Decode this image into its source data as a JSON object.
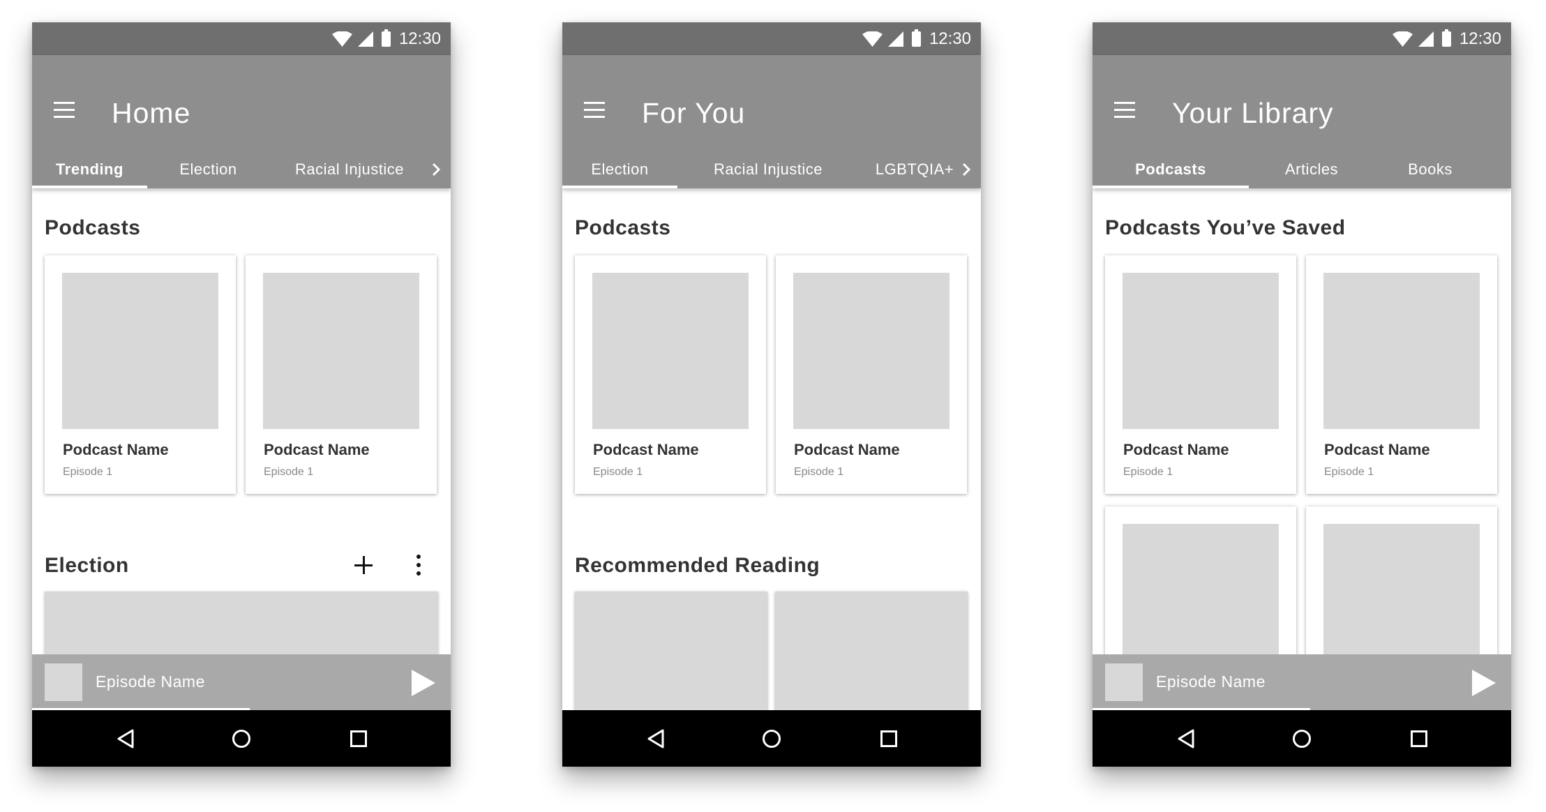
{
  "status_bar": {
    "time": "12:30"
  },
  "screens": [
    {
      "title": "Home",
      "tabs": [
        "Trending",
        "Election",
        "Racial Injustice"
      ],
      "section_1": {
        "title": "Podcasts",
        "cards": [
          {
            "title": "Podcast Name",
            "subtitle": "Episode 1"
          },
          {
            "title": "Podcast Name",
            "subtitle": "Episode 1"
          }
        ]
      },
      "section_2": {
        "title": "Election"
      },
      "mini_player": {
        "episode": "Episode Name",
        "progress": 0.52
      }
    },
    {
      "title": "For You",
      "tabs": [
        "Election",
        "Racial Injustice",
        "LGBTQIA+"
      ],
      "section_1": {
        "title": "Podcasts",
        "cards": [
          {
            "title": "Podcast Name",
            "subtitle": "Episode 1"
          },
          {
            "title": "Podcast Name",
            "subtitle": "Episode 1"
          }
        ]
      },
      "section_2": {
        "title": "Recommended Reading"
      }
    },
    {
      "title": "Your Library",
      "tabs": [
        "Podcasts",
        "Articles",
        "Books"
      ],
      "section_1": {
        "title": "Podcasts You’ve Saved",
        "cards": [
          {
            "title": "Podcast Name",
            "subtitle": "Episode 1"
          },
          {
            "title": "Podcast Name",
            "subtitle": "Episode 1"
          }
        ]
      },
      "mini_player": {
        "episode": "Episode Name",
        "progress": 0.52
      }
    }
  ],
  "colors": {
    "status_bar": "#6f6f6f",
    "app_bar": "#8e8e8e",
    "placeholder": "#d8d8d8",
    "mini_player": "#a9a9a9",
    "nav_bar": "#000000"
  }
}
